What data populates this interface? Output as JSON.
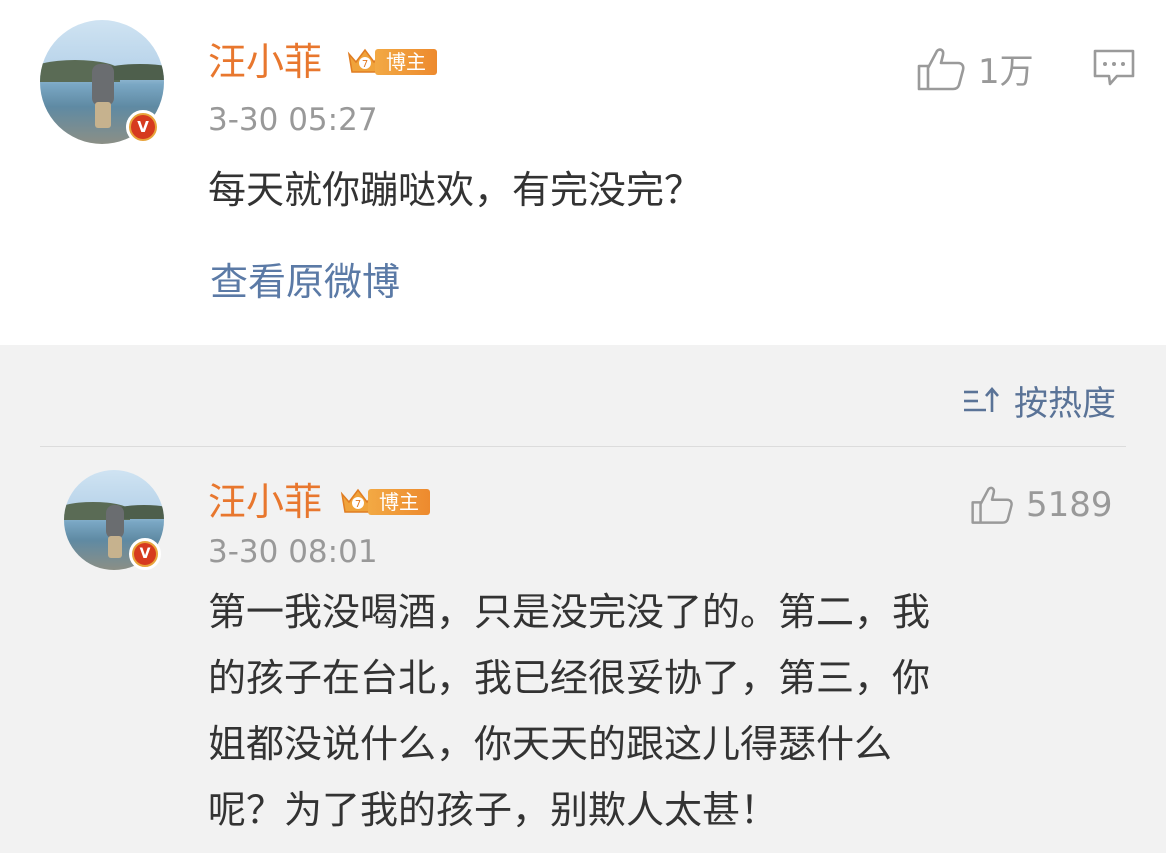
{
  "post": {
    "username": "汪小菲",
    "badge_label": "博主",
    "timestamp": "3-30 05:27",
    "text": "每天就你蹦哒欢，有完没完？",
    "like_count": "1万",
    "view_original": "查看原微博"
  },
  "sort": {
    "label": "按热度"
  },
  "reply": {
    "username": "汪小菲",
    "badge_label": "博主",
    "timestamp": "3-30 08:01",
    "like_count": "5189",
    "lines": [
      "第一我没喝酒，只是没完没了的。第二，我",
      "的孩子在台北，我已经很妥协了，第三，你",
      "姐都没说什么，你天天的跟这儿得瑟什么",
      "呢？为了我的孩子，别欺人太甚！"
    ]
  },
  "icons": {
    "like": "thumbs-up-icon",
    "comment": "comment-icon",
    "sort": "sort-icon",
    "verified": "verified-v-icon",
    "crown": "crown-icon"
  },
  "colors": {
    "username": "#e8772e",
    "link": "#5b7aa6",
    "muted": "#999999",
    "text": "#333333",
    "background": "#f2f2f2"
  }
}
